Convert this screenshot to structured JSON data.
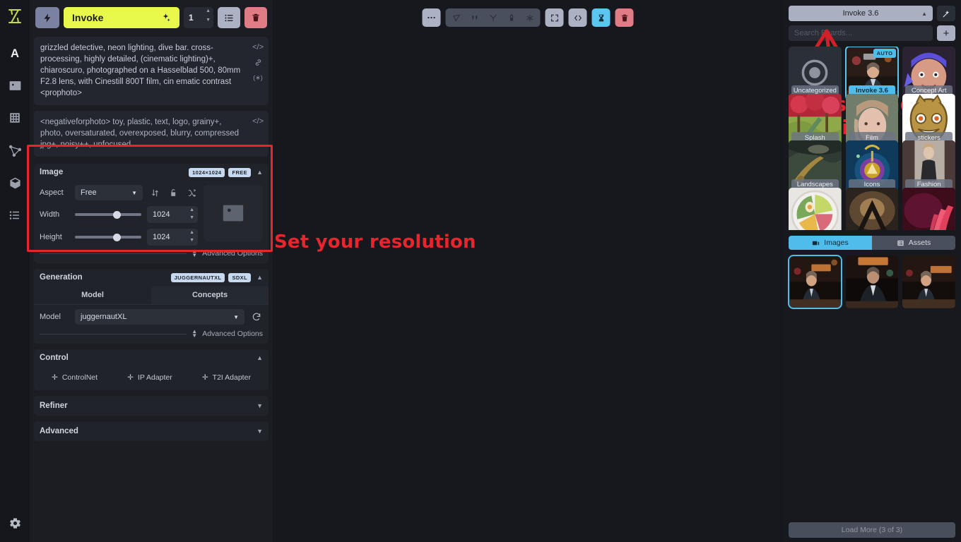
{
  "rail": {
    "logo": "invoke-logo",
    "items": [
      {
        "name": "text-to-image",
        "icon": "letter-a-icon",
        "active": true
      },
      {
        "name": "image-to-image",
        "icon": "picture-icon",
        "active": false
      },
      {
        "name": "unified-canvas",
        "icon": "grid-icon",
        "active": false
      },
      {
        "name": "node-editor",
        "icon": "nodes-icon",
        "active": false
      },
      {
        "name": "model-manager",
        "icon": "cube-icon",
        "active": false
      },
      {
        "name": "queue",
        "icon": "list-icon",
        "active": false
      }
    ],
    "settings_icon": "gear-icon"
  },
  "toolbar": {
    "bolt_icon": "lightning-icon",
    "invoke_label": "Invoke",
    "invoke_icon": "sparkles-icon",
    "iterations": "1",
    "list_icon": "queue-list-icon",
    "trash_icon": "trash-icon"
  },
  "prompts": {
    "positive": "grizzled detective, neon lighting, dive bar. cross-processing, highly detailed, (cinematic lighting)+, chiaroscuro, photographed on a Hasselblad 500, 80mm F2.8 lens, with Cinestill 800T film, cin ematic contrast <prophoto>",
    "negative": "<negativeforphoto> toy, plastic, text, logo, grainy+, photo, oversaturated, overexposed, blurry, compressed jpg+, noisy++, unfocused",
    "pos_icons": [
      "code-icon",
      "link-icon",
      "asterisk-circle-icon"
    ],
    "neg_icons": [
      "code-icon"
    ]
  },
  "image_section": {
    "title": "Image",
    "badge_size": "1024×1024",
    "badge_mode": "FREE",
    "aspect_label": "Aspect",
    "aspect_value": "Free",
    "swap_icon": "swap-dimensions-icon",
    "lock_icon": "lock-aspect-icon",
    "shuffle_icon": "randomize-icon",
    "width_label": "Width",
    "width_value": "1024",
    "height_label": "Height",
    "height_value": "1024",
    "preview_icon": "image-placeholder-icon",
    "advanced_label": "Advanced Options"
  },
  "generation_section": {
    "title": "Generation",
    "badge_model": "JUGGERNAUTXL",
    "badge_base": "SDXL",
    "tab_model": "Model",
    "tab_concepts": "Concepts",
    "model_label": "Model",
    "model_value": "juggernautXL",
    "refresh_icon": "refresh-icon",
    "advanced_label": "Advanced Options"
  },
  "control_section": {
    "title": "Control",
    "buttons": [
      {
        "label": "ControlNet",
        "icon": "plus-icon"
      },
      {
        "label": "IP Adapter",
        "icon": "plus-icon"
      },
      {
        "label": "T2I Adapter",
        "icon": "plus-icon"
      }
    ]
  },
  "collapsed_sections": [
    {
      "title": "Refiner"
    },
    {
      "title": "Advanced"
    }
  ],
  "canvas_toolbar": {
    "more_icon": "ellipsis-icon",
    "group": [
      {
        "icon": "send-to-canvas-icon"
      },
      {
        "icon": "quotes-icon"
      },
      {
        "icon": "use-seed-icon"
      },
      {
        "icon": "battery-icon"
      },
      {
        "icon": "asterisk-icon"
      }
    ],
    "fullscreen_icon": "expand-icon",
    "metadata_icon": "code-icon",
    "upscale_icon": "hourglass-upscale-icon",
    "delete_icon": "trash-icon"
  },
  "annotations": {
    "upscaling": "Upscaling option",
    "resolution": "Set your resolution",
    "color": "#e8242c"
  },
  "gallery": {
    "board_select": "Invoke 3.6",
    "wand_icon": "wand-icon",
    "search_placeholder": "Search Boards...",
    "add_board_icon": "plus-icon",
    "boards": [
      {
        "label": "Uncategorized",
        "type": "ring",
        "selected": false,
        "auto": false
      },
      {
        "label": "Invoke 3.6",
        "type": "detective",
        "selected": true,
        "auto": true,
        "auto_label": "AUTO"
      },
      {
        "label": "Concept Art",
        "type": "concept",
        "selected": false,
        "auto": false
      },
      {
        "label": "Splash",
        "type": "splash",
        "selected": false,
        "auto": false
      },
      {
        "label": "Film",
        "type": "film",
        "selected": false,
        "auto": false
      },
      {
        "label": "stickers",
        "type": "sticker",
        "selected": false,
        "auto": false
      },
      {
        "label": "Landscapes",
        "type": "landscape",
        "selected": false,
        "auto": false
      },
      {
        "label": "Icons",
        "type": "icons",
        "selected": false,
        "auto": false
      },
      {
        "label": "Fashion",
        "type": "fashion",
        "selected": false,
        "auto": false
      },
      {
        "label": "",
        "type": "food",
        "selected": false,
        "auto": false
      },
      {
        "label": "",
        "type": "arch",
        "selected": false,
        "auto": false
      },
      {
        "label": "",
        "type": "pink",
        "selected": false,
        "auto": false
      }
    ],
    "tabs": [
      {
        "label": "Images",
        "icon": "images-icon",
        "active": true
      },
      {
        "label": "Assets",
        "icon": "assets-icon",
        "active": false
      }
    ],
    "images": [
      {
        "type": "detective-a",
        "selected": true
      },
      {
        "type": "detective-b",
        "selected": false
      },
      {
        "type": "detective-c",
        "selected": false
      }
    ],
    "load_more": "Load More (3 of 3)"
  }
}
